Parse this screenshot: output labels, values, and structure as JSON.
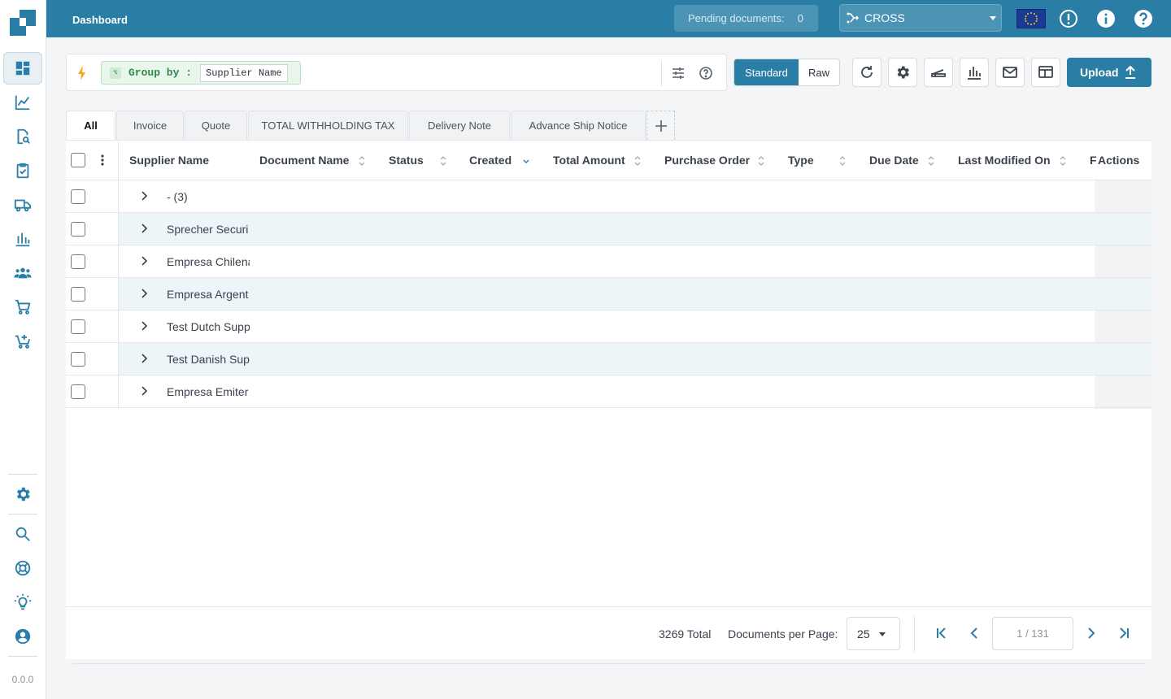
{
  "app": {
    "version": "0.0.0"
  },
  "topbar": {
    "title": "Dashboard",
    "pending_label": "Pending documents:",
    "pending_count": "0",
    "company": "CROSS",
    "region_flag": "eu-flag-icon"
  },
  "sidebar": {
    "items": [
      "dashboard-icon",
      "analytics-icon",
      "document-search-icon",
      "clipboard-check-icon",
      "truck-icon",
      "bar-chart-icon",
      "users-icon",
      "cart-icon",
      "cart-add-icon"
    ],
    "bottom": [
      "gear-icon",
      "search-icon",
      "lifebuoy-icon",
      "lightbulb-icon",
      "account-icon"
    ]
  },
  "query": {
    "group_by_label": "Group by :",
    "group_by_value": "Supplier Name"
  },
  "view_mode": {
    "standard": "Standard",
    "raw": "Raw",
    "selected": "Standard"
  },
  "upload_label": "Upload",
  "tabs": [
    "All",
    "Invoice",
    "Quote",
    "TOTAL WITHHOLDING TAX",
    "Delivery Note",
    "Advance Ship Notice"
  ],
  "active_tab": "All",
  "table": {
    "columns": [
      "Supplier Name",
      "Document Name",
      "Status",
      "Created",
      "Total Amount",
      "Purchase Order",
      "Type",
      "Due Date",
      "Last Modified On",
      "F",
      "Actions"
    ],
    "rows": [
      {
        "label": "- (3)"
      },
      {
        "label": "Sprecher Securi"
      },
      {
        "label": "Empresa Chilena"
      },
      {
        "label": "Empresa Argent"
      },
      {
        "label": "Test Dutch Supp"
      },
      {
        "label": "Test Danish Sup"
      },
      {
        "label": "Empresa Emiter"
      }
    ]
  },
  "footer": {
    "total": "3269 Total",
    "per_page_label": "Documents per Page:",
    "per_page": "25",
    "page": "1 / 131"
  },
  "colors": {
    "brand": "#2a7ea6",
    "row_alt": "#eef5f8"
  }
}
